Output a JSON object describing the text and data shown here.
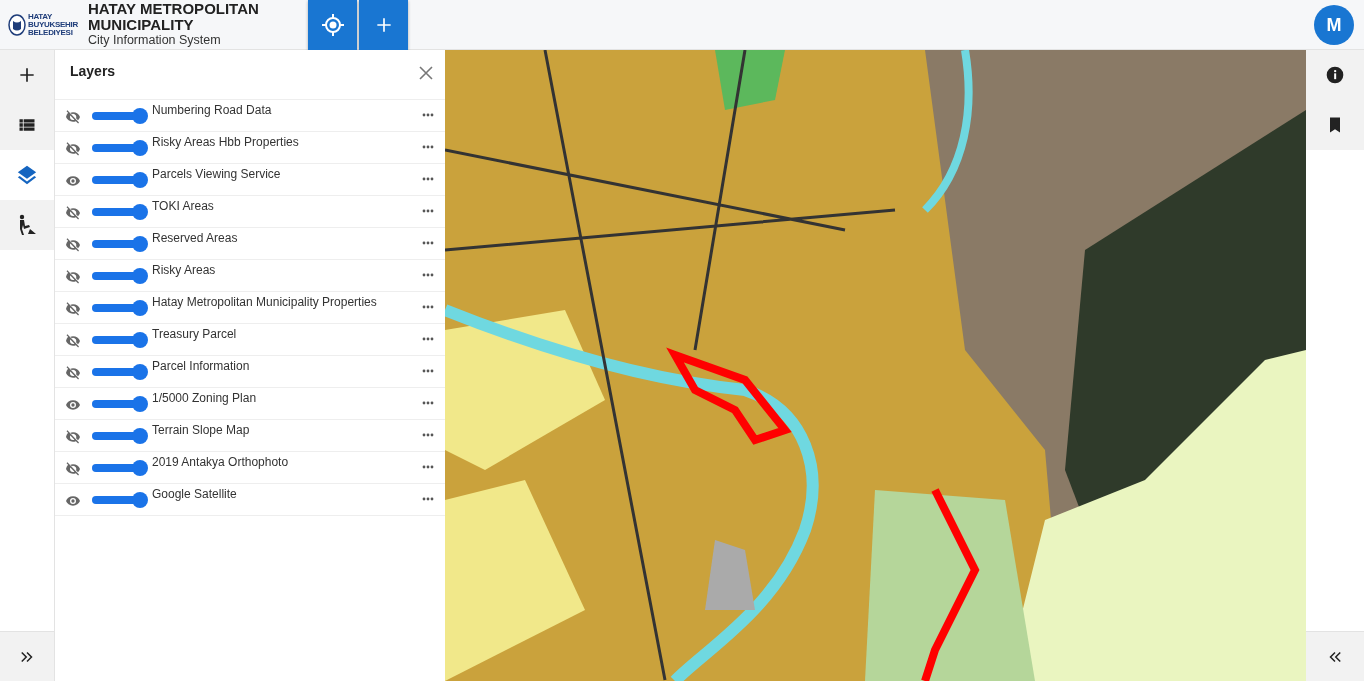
{
  "header": {
    "logo_lines": [
      "HATAY",
      "BUYUKSEHIR",
      "BELEDIYESI"
    ],
    "title": "HATAY METROPOLITAN MUNICIPALITY",
    "subtitle": "City Information System",
    "actions": [
      {
        "kind": "locate"
      },
      {
        "kind": "add"
      }
    ],
    "avatar": "M"
  },
  "left_rail": [
    {
      "kind": "add",
      "selected": false
    },
    {
      "kind": "list",
      "selected": false
    },
    {
      "kind": "layers",
      "selected": true
    },
    {
      "kind": "worker",
      "selected": false
    }
  ],
  "panel": {
    "title": "Layers",
    "layers": [
      {
        "name": "Numbering Road Data",
        "visible": false,
        "level": 1
      },
      {
        "name": "Risky Areas Hbb Properties",
        "visible": false,
        "level": 1
      },
      {
        "name": "Parcels Viewing Service",
        "visible": true,
        "level": 1
      },
      {
        "name": "TOKI Areas",
        "visible": false,
        "level": 1
      },
      {
        "name": "Reserved Areas",
        "visible": false,
        "level": 1
      },
      {
        "name": "Risky Areas",
        "visible": false,
        "level": 1
      },
      {
        "name": "Hatay Metropolitan Municipality Properties",
        "visible": false,
        "level": 1
      },
      {
        "name": "Treasury Parcel",
        "visible": false,
        "level": 1
      },
      {
        "name": "Parcel Information",
        "visible": false,
        "level": 1
      },
      {
        "name": "1/5000 Zoning Plan",
        "visible": true,
        "level": 1
      },
      {
        "name": "Terrain Slope Map",
        "visible": false,
        "level": 1
      },
      {
        "name": "2019 Antakya Orthophoto",
        "visible": false,
        "level": 1
      },
      {
        "name": "Google Satellite",
        "visible": true,
        "level": 1
      }
    ]
  },
  "right_rail": [
    {
      "kind": "info"
    },
    {
      "kind": "bookmark"
    }
  ]
}
